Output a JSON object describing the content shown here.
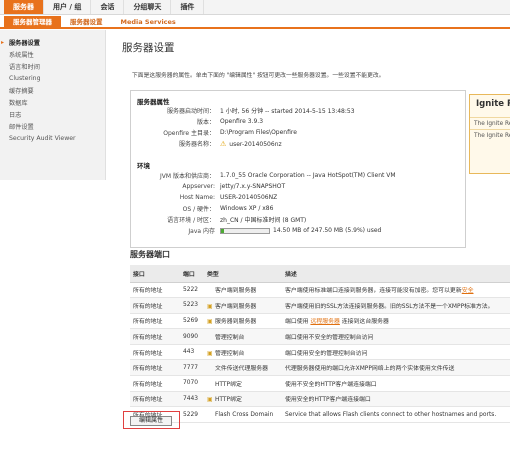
{
  "topnav": {
    "tabs": [
      {
        "label": "服务器",
        "active": true
      },
      {
        "label": "用户 / 组",
        "active": false
      },
      {
        "label": "会话",
        "active": false
      },
      {
        "label": "分组聊天",
        "active": false
      },
      {
        "label": "插件",
        "active": false
      }
    ]
  },
  "subnav": {
    "tabs": [
      {
        "label": "服务器管理器",
        "active": true
      },
      {
        "label": "服务器设置",
        "active": false
      },
      {
        "label": "Media Services",
        "active": false
      }
    ]
  },
  "sidebar": {
    "items": [
      {
        "label": "服务器设置",
        "active": true
      },
      {
        "label": "系统属性",
        "active": false
      },
      {
        "label": "语言和时间",
        "active": false
      },
      {
        "label": "Clustering",
        "active": false
      },
      {
        "label": "缓存摘要",
        "active": false
      },
      {
        "label": "数据库",
        "active": false
      },
      {
        "label": "日志",
        "active": false
      },
      {
        "label": "邮件设置",
        "active": false
      },
      {
        "label": "Security Audit Viewer",
        "active": false
      }
    ]
  },
  "page": {
    "title": "服务器设置",
    "intro": "下面是这服务器的属性。单击下面的 \"编辑属性\" 按钮可更改一些服务器设置。一些设置不能更改。"
  },
  "server_props": {
    "heading": "服务器属性",
    "rows": [
      {
        "key": "服务器启动时间：",
        "value": "1 小时, 56 分钟 -- started 2014-5-15 13:48:53"
      },
      {
        "key": "版本：",
        "value": "Openfire 3.9.3"
      },
      {
        "key": "Openfire 主目录：",
        "value": "D:\\Program Files\\Openfire"
      },
      {
        "key": "服务器名称：",
        "value": "user-20140506nz"
      }
    ]
  },
  "env": {
    "heading": "环境",
    "rows": [
      {
        "key": "JVM 版本和供应商：",
        "value": "1.7.0_55 Oracle Corporation -- Java HotSpot(TM) Client VM"
      },
      {
        "key": "Appserver:",
        "value": "jetty/7.x.y-SNAPSHOT"
      },
      {
        "key": "Host Name:",
        "value": "USER-20140506NZ"
      },
      {
        "key": "OS / 硬件：",
        "value": "Windows XP / x86"
      },
      {
        "key": "语言环境 / 时区：",
        "value": "zh_CN / 中国标准时间 (8 GMT)"
      },
      {
        "key": "Java 内存",
        "value": "14.50 MB of 247.50 MB (5.9%) used"
      }
    ],
    "memory_used_fraction": 0.059
  },
  "ignite": {
    "title": "Ignite Re",
    "lines": [
      "The Ignite Re",
      "The Ignite Re"
    ]
  },
  "ports": {
    "heading": "服务器端口",
    "columns": [
      "接口",
      "端口",
      "类型",
      "描述"
    ],
    "rows": [
      {
        "iface": "所有的地址",
        "port": "5222",
        "lock": false,
        "type": "客户端到服务器",
        "desc": "客户端使用标准端口连接到服务器，连接可能没有加密。您可以更新",
        "desc_link": "安全"
      },
      {
        "iface": "所有的地址",
        "port": "5223",
        "lock": true,
        "type": "客户端到服务器",
        "desc": "客户端使用旧的SSL方法连接到服务器。旧的SSL方法不是一个XMPP标准方法。"
      },
      {
        "iface": "所有的地址",
        "port": "5269",
        "lock": true,
        "type": "服务器到服务器",
        "desc_pre": "端口使用 ",
        "desc_link": "远程服务器",
        "desc": " 连接到这台服务器"
      },
      {
        "iface": "所有的地址",
        "port": "9090",
        "lock": false,
        "type": "管理控制台",
        "desc": "端口使用不安全的管理控制台访问"
      },
      {
        "iface": "所有的地址",
        "port": "443",
        "lock": true,
        "type": "管理控制台",
        "desc": "端口使用安全的管理控制台访问"
      },
      {
        "iface": "所有的地址",
        "port": "7777",
        "lock": false,
        "type": "文件传送代理服务器",
        "desc": "代理服务器使用的端口允许XMPP网络上的两个实体使用文件传送"
      },
      {
        "iface": "所有的地址",
        "port": "7070",
        "lock": false,
        "type": "HTTP绑定",
        "desc": "使用不安全的HTTP客户端连接端口"
      },
      {
        "iface": "所有的地址",
        "port": "7443",
        "lock": true,
        "type": "HTTP绑定",
        "desc": "使用安全的HTTP客户端连接端口"
      },
      {
        "iface": "所有的地址",
        "port": "5229",
        "lock": false,
        "type": "Flash Cross Domain",
        "desc": "Service that allows Flash clients connect to other hostnames and ports."
      }
    ]
  },
  "edit_button": {
    "label": "编辑属性"
  },
  "colors": {
    "accent": "#e8721c",
    "link": "#e07010",
    "warning": "#e0a000"
  },
  "icons": {
    "warning": "warning-icon",
    "lock": "lock-icon",
    "bullet": "bullet-icon"
  }
}
